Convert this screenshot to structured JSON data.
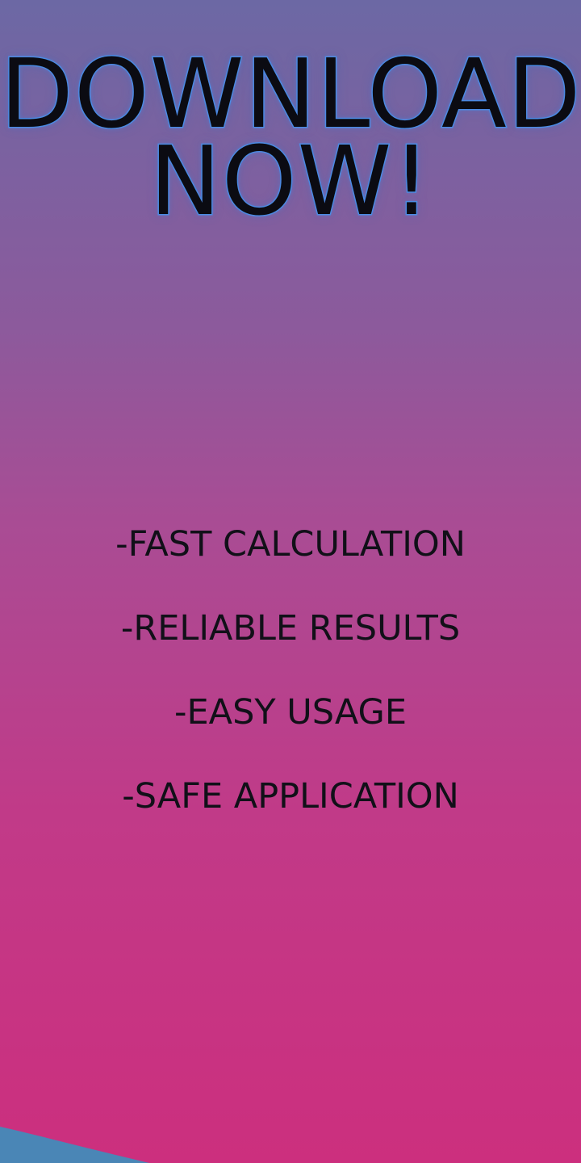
{
  "headline": {
    "line1": "DOWNLOAD",
    "line2": "NOW!"
  },
  "features": [
    "-FAST CALCULATION",
    "-RELIABLE RESULTS",
    "-EASY USAGE",
    "-SAFE APPLICATION"
  ],
  "colors": {
    "background_top": "#6c68a4",
    "background_bottom": "#cc2f7e",
    "headline_fill": "#0b0b12",
    "headline_outline": "#4e8fe6",
    "feature_text": "#111018",
    "corner_wave": "#4a86b6"
  }
}
